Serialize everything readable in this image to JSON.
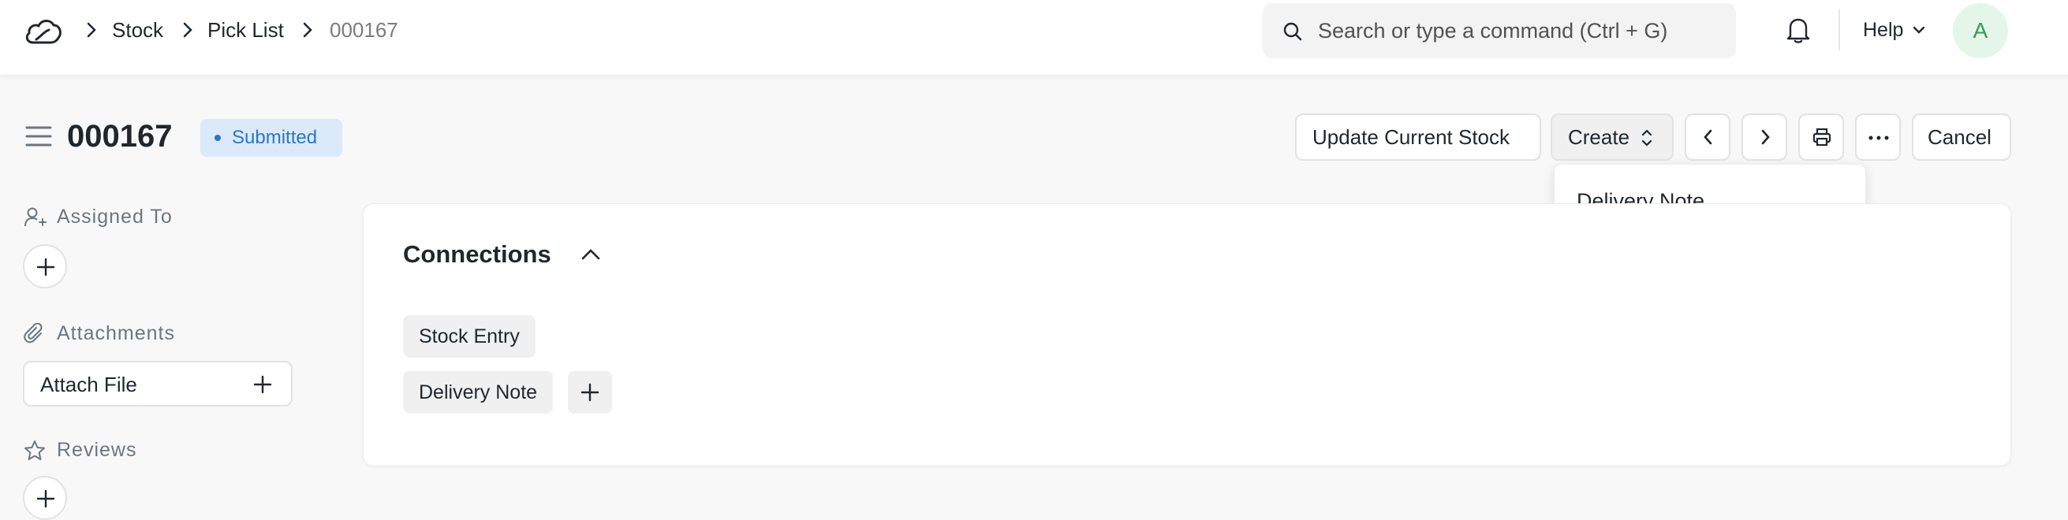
{
  "navbar": {
    "logo_icon": "cloud-logo-icon",
    "breadcrumbs": [
      "Stock",
      "Pick List",
      "000167"
    ],
    "search": {
      "placeholder": "Search or type a command (Ctrl + G)",
      "value": ""
    },
    "notifications_icon": "bell-icon",
    "help_label": "Help",
    "avatar_initial": "A"
  },
  "header": {
    "title": "000167",
    "status": "Submitted",
    "status_color": "#2877c9",
    "actions": {
      "update_stock": "Update Current Stock",
      "create": "Create",
      "cancel": "Cancel"
    },
    "create_menu": [
      "Delivery Note"
    ]
  },
  "sidebar": {
    "assigned_to": "Assigned To",
    "attachments": "Attachments",
    "attach_file": "Attach File",
    "reviews": "Reviews"
  },
  "connections": {
    "title": "Connections",
    "items": [
      "Stock Entry",
      "Delivery Note"
    ]
  },
  "colors": {
    "accent_blue": "#2877c9",
    "status_bg": "#dbeafb",
    "avatar_green": "#2f9d58"
  }
}
